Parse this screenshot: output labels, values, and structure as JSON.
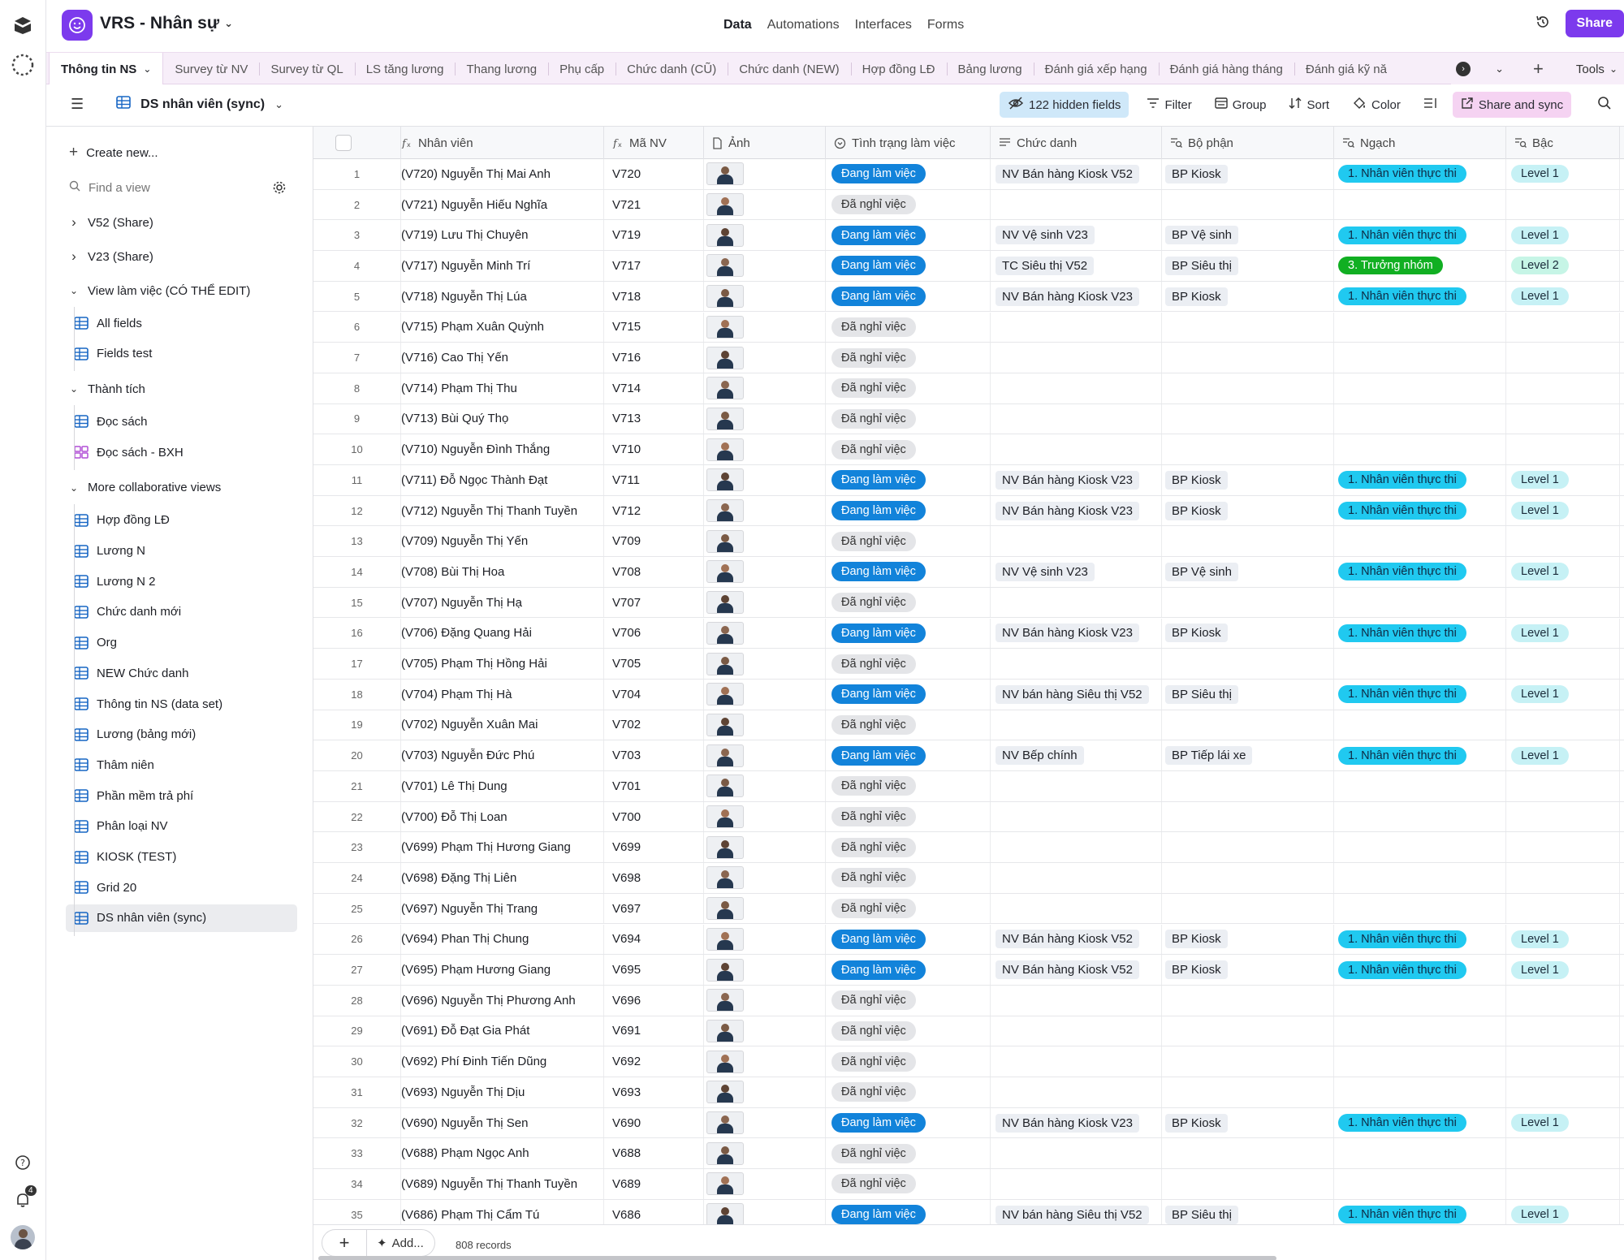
{
  "app": {
    "title": "VRS - Nhân sự"
  },
  "nav": {
    "data": "Data",
    "automations": "Automations",
    "interfaces": "Interfaces",
    "forms": "Forms",
    "share": "Share"
  },
  "tabs": [
    "Thông tin NS",
    "Survey từ NV",
    "Survey từ QL",
    "LS tăng lương",
    "Thang lương",
    "Phụ cấp",
    "Chức danh (CŨ)",
    "Chức danh (NEW)",
    "Hợp đồng LĐ",
    "Bảng lương",
    "Đánh giá xếp hạng",
    "Đánh giá hàng tháng",
    "Đánh giá kỹ nă"
  ],
  "tabs_tools": "Tools",
  "viewbar": {
    "view_name": "DS nhân viên (sync)",
    "hidden_fields": "122 hidden fields",
    "filter": "Filter",
    "group": "Group",
    "sort": "Sort",
    "color": "Color",
    "share_sync": "Share and sync"
  },
  "sidebar": {
    "create_new": "Create new...",
    "find_placeholder": "Find a view",
    "groups": [
      {
        "label": "V52 (Share)"
      },
      {
        "label": "V23 (Share)"
      },
      {
        "label": "View làm việc (CÓ THỂ EDIT)",
        "views": [
          "All fields",
          "Fields test"
        ]
      },
      {
        "label": "Thành tích",
        "views": [
          "Đọc sách",
          "Đọc sách - BXH"
        ]
      },
      {
        "label": "More collaborative views",
        "views": [
          "Hợp đồng LĐ",
          "Lương N",
          "Lương N 2",
          "Chức danh mới",
          "Org",
          "NEW Chức danh",
          "Thông tin NS (data set)",
          "Lương (bảng mới)",
          "Thâm niên",
          "Phần mềm trả phí",
          "Phân loại NV",
          "KIOSK (TEST)",
          "Grid 20",
          "DS nhân viên (sync)"
        ]
      }
    ]
  },
  "rail": {
    "notification_count": "4"
  },
  "columns": [
    "Nhân viên",
    "Mã NV",
    "Ảnh",
    "Tình trạng làm việc",
    "Chức danh",
    "Bộ phận",
    "Ngạch",
    "Bậc"
  ],
  "status_labels": {
    "working": "Đang làm việc",
    "quit": "Đã nghỉ việc"
  },
  "rows": [
    {
      "n": "1",
      "name": "(V720) Nguyễn Thị Mai Anh",
      "id": "V720",
      "st": "working",
      "title": "NV Bán hàng Kiosk V52",
      "dept": "BP Kiosk",
      "rank": "1. Nhân viên thực thi",
      "lvl": "Level 1"
    },
    {
      "n": "2",
      "name": "(V721) Nguyễn Hiếu Nghĩa",
      "id": "V721",
      "st": "quit"
    },
    {
      "n": "3",
      "name": "(V719) Lưu Thị Chuyên",
      "id": "V719",
      "st": "working",
      "title": "NV Vệ sinh V23",
      "dept": "BP Vệ sinh",
      "rank": "1. Nhân viên thực thi",
      "lvl": "Level 1"
    },
    {
      "n": "4",
      "name": "(V717) Nguyễn Minh Trí",
      "id": "V717",
      "st": "working",
      "title": "TC Siêu thị V52",
      "dept": "BP Siêu thị",
      "rank": "3. Trưởng nhóm",
      "lvl": "Level 2"
    },
    {
      "n": "5",
      "name": "(V718) Nguyễn Thị Lúa",
      "id": "V718",
      "st": "working",
      "title": "NV Bán hàng Kiosk V23",
      "dept": "BP Kiosk",
      "rank": "1. Nhân viên thực thi",
      "lvl": "Level 1"
    },
    {
      "n": "6",
      "name": "(V715) Phạm Xuân Quỳnh",
      "id": "V715",
      "st": "quit"
    },
    {
      "n": "7",
      "name": "(V716) Cao Thị Yến",
      "id": "V716",
      "st": "quit"
    },
    {
      "n": "8",
      "name": "(V714) Phạm Thị Thu",
      "id": "V714",
      "st": "quit"
    },
    {
      "n": "9",
      "name": "(V713) Bùi Quý Thọ",
      "id": "V713",
      "st": "quit"
    },
    {
      "n": "10",
      "name": "(V710) Nguyễn Đình Thắng",
      "id": "V710",
      "st": "quit"
    },
    {
      "n": "11",
      "name": "(V711) Đỗ Ngọc Thành Đạt",
      "id": "V711",
      "st": "working",
      "title": "NV Bán hàng Kiosk V23",
      "dept": "BP Kiosk",
      "rank": "1. Nhân viên thực thi",
      "lvl": "Level 1"
    },
    {
      "n": "12",
      "name": "(V712) Nguyễn Thị Thanh Tuyền",
      "id": "V712",
      "st": "working",
      "title": "NV Bán hàng Kiosk V23",
      "dept": "BP Kiosk",
      "rank": "1. Nhân viên thực thi",
      "lvl": "Level 1"
    },
    {
      "n": "13",
      "name": "(V709) Nguyễn Thị Yến",
      "id": "V709",
      "st": "quit"
    },
    {
      "n": "14",
      "name": "(V708) Bùi Thị Hoa",
      "id": "V708",
      "st": "working",
      "title": "NV Vệ sinh V23",
      "dept": "BP Vệ sinh",
      "rank": "1. Nhân viên thực thi",
      "lvl": "Level 1"
    },
    {
      "n": "15",
      "name": "(V707) Nguyễn Thị Hạ",
      "id": "V707",
      "st": "quit"
    },
    {
      "n": "16",
      "name": "(V706) Đặng Quang Hải",
      "id": "V706",
      "st": "working",
      "title": "NV Bán hàng Kiosk V23",
      "dept": "BP Kiosk",
      "rank": "1. Nhân viên thực thi",
      "lvl": "Level 1"
    },
    {
      "n": "17",
      "name": "(V705) Phạm Thị Hồng Hải",
      "id": "V705",
      "st": "quit"
    },
    {
      "n": "18",
      "name": "(V704) Phạm Thị Hà",
      "id": "V704",
      "st": "working",
      "title": "NV bán hàng Siêu thị V52",
      "dept": "BP Siêu thị",
      "rank": "1. Nhân viên thực thi",
      "lvl": "Level 1"
    },
    {
      "n": "19",
      "name": "(V702) Nguyễn Xuân Mai",
      "id": "V702",
      "st": "quit"
    },
    {
      "n": "20",
      "name": "(V703) Nguyễn Đức Phú",
      "id": "V703",
      "st": "working",
      "title": "NV Bếp chính",
      "dept": "BP Tiếp lái xe",
      "rank": "1. Nhân viên thực thi",
      "lvl": "Level 1"
    },
    {
      "n": "21",
      "name": "(V701) Lê Thị Dung",
      "id": "V701",
      "st": "quit"
    },
    {
      "n": "22",
      "name": "(V700) Đỗ Thị Loan",
      "id": "V700",
      "st": "quit"
    },
    {
      "n": "23",
      "name": "(V699) Phạm Thị Hương Giang",
      "id": "V699",
      "st": "quit"
    },
    {
      "n": "24",
      "name": "(V698) Đặng Thị Liên",
      "id": "V698",
      "st": "quit"
    },
    {
      "n": "25",
      "name": "(V697) Nguyễn Thị Trang",
      "id": "V697",
      "st": "quit"
    },
    {
      "n": "26",
      "name": "(V694) Phan Thị Chung",
      "id": "V694",
      "st": "working",
      "title": "NV Bán hàng Kiosk V52",
      "dept": "BP Kiosk",
      "rank": "1. Nhân viên thực thi",
      "lvl": "Level 1"
    },
    {
      "n": "27",
      "name": "(V695) Phạm Hương Giang",
      "id": "V695",
      "st": "working",
      "title": "NV Bán hàng Kiosk V52",
      "dept": "BP Kiosk",
      "rank": "1. Nhân viên thực thi",
      "lvl": "Level 1"
    },
    {
      "n": "28",
      "name": "(V696) Nguyễn Thị Phương Anh",
      "id": "V696",
      "st": "quit"
    },
    {
      "n": "29",
      "name": "(V691) Đỗ Đạt Gia Phát",
      "id": "V691",
      "st": "quit"
    },
    {
      "n": "30",
      "name": "(V692) Phí Đinh Tiến Dũng",
      "id": "V692",
      "st": "quit"
    },
    {
      "n": "31",
      "name": "(V693) Nguyễn Thị Dịu",
      "id": "V693",
      "st": "quit"
    },
    {
      "n": "32",
      "name": "(V690) Nguyễn Thị Sen",
      "id": "V690",
      "st": "working",
      "title": "NV Bán hàng Kiosk V23",
      "dept": "BP Kiosk",
      "rank": "1. Nhân viên thực thi",
      "lvl": "Level 1"
    },
    {
      "n": "33",
      "name": "(V688) Phạm Ngọc Anh",
      "id": "V688",
      "st": "quit"
    },
    {
      "n": "34",
      "name": "(V689) Nguyễn Thị Thanh Tuyền",
      "id": "V689",
      "st": "quit"
    },
    {
      "n": "35",
      "name": "(V686) Phạm Thị Cẩm Tú",
      "id": "V686",
      "st": "working",
      "title": "NV bán hàng Siêu thị V52",
      "dept": "BP Siêu thị",
      "rank": "1. Nhân viên thực thi",
      "lvl": "Level 1"
    }
  ],
  "footer": {
    "add": "Add...",
    "records": "808 records"
  },
  "colors": {
    "accent": "#7c3aed",
    "working": "#1283da",
    "quit": "#e4e5e8",
    "rank": "#20c9f0",
    "lead": "#11af22",
    "level": "#c6f1f5",
    "tabbar": "#f7eef9"
  }
}
